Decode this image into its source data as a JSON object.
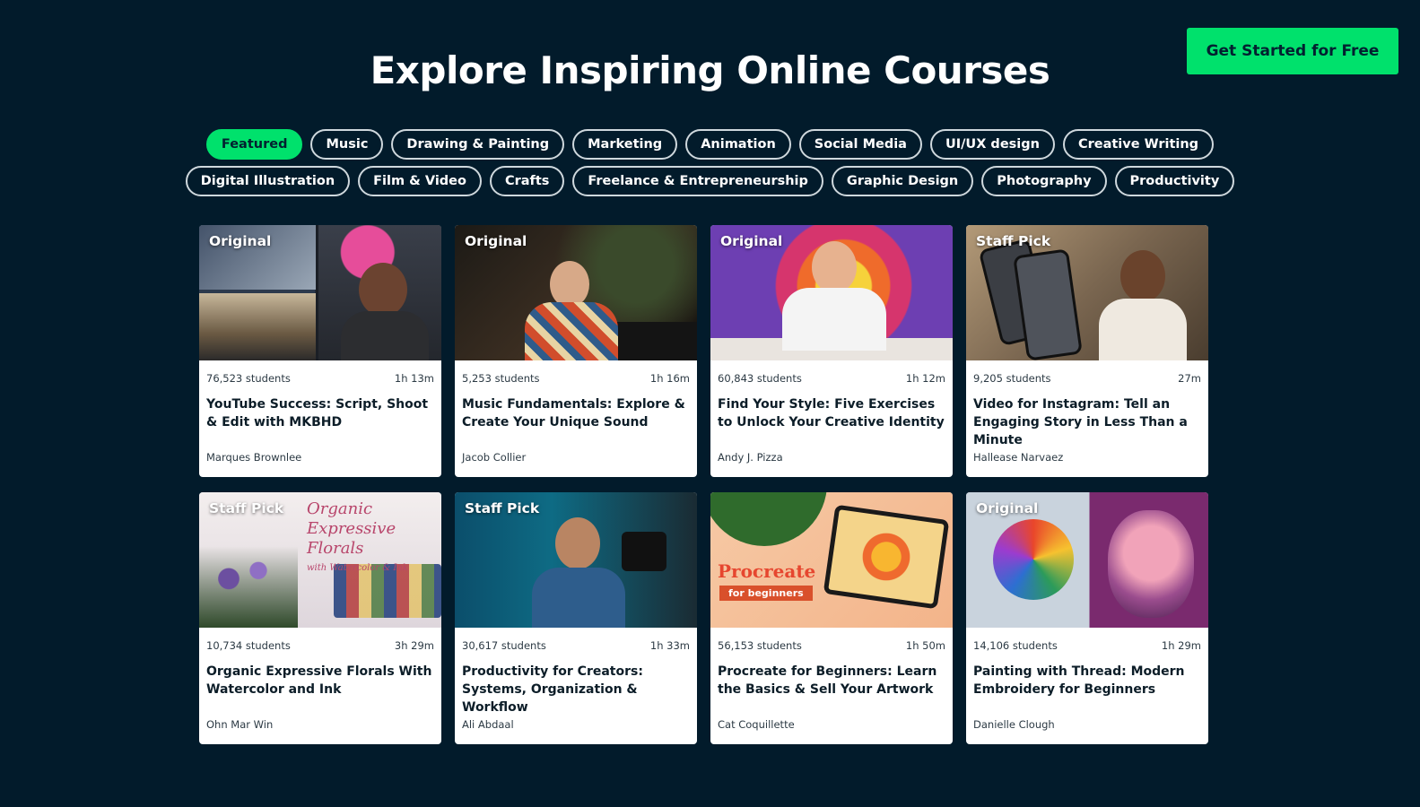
{
  "header": {
    "cta_label": "Get Started for Free",
    "title": "Explore Inspiring Online Courses"
  },
  "categories": {
    "row1": [
      "Featured",
      "Music",
      "Drawing & Painting",
      "Marketing",
      "Animation",
      "Social Media",
      "UI/UX design",
      "Creative Writing"
    ],
    "row2": [
      "Digital Illustration",
      "Film & Video",
      "Crafts",
      "Freelance & Entrepreneurship",
      "Graphic Design",
      "Photography",
      "Productivity"
    ],
    "active": "Featured"
  },
  "courses": [
    {
      "badge": "Original",
      "students": "76,523 students",
      "duration": "1h 13m",
      "title": "YouTube Success: Script, Shoot & Edit with MKBHD",
      "teacher": "Marques Brownlee"
    },
    {
      "badge": "Original",
      "students": "5,253 students",
      "duration": "1h 16m",
      "title": "Music Fundamentals: Explore & Create Your Unique Sound",
      "teacher": "Jacob Collier"
    },
    {
      "badge": "Original",
      "students": "60,843 students",
      "duration": "1h 12m",
      "title": "Find Your Style: Five Exercises to Unlock Your Creative Identity",
      "teacher": "Andy J. Pizza"
    },
    {
      "badge": "Staff Pick",
      "students": "9,205 students",
      "duration": "27m",
      "title": "Video for Instagram: Tell an Engaging Story in Less Than a Minute",
      "teacher": "Hallease Narvaez"
    },
    {
      "badge": "Staff Pick",
      "students": "10,734 students",
      "duration": "3h 29m",
      "title": "Organic Expressive Florals With Watercolor and Ink",
      "teacher": "Ohn Mar Win",
      "thumb_text": [
        "Organic Expressive",
        "Florals",
        "with Watercolor & Ink"
      ]
    },
    {
      "badge": "Staff Pick",
      "students": "30,617 students",
      "duration": "1h 33m",
      "title": "Productivity for Creators: Systems, Organization & Workflow",
      "teacher": "Ali Abdaal"
    },
    {
      "badge": "",
      "students": "56,153 students",
      "duration": "1h 50m",
      "title": "Procreate for Beginners: Learn the Basics & Sell Your Artwork",
      "teacher": "Cat Coquillette",
      "thumb_text": [
        "Procreate",
        "for beginners"
      ]
    },
    {
      "badge": "Original",
      "students": "14,106 students",
      "duration": "1h 29m",
      "title": "Painting with Thread: Modern Embroidery for Beginners",
      "teacher": "Danielle Clough"
    }
  ],
  "colors": {
    "background": "#021b2b",
    "accent": "#00e16c"
  }
}
